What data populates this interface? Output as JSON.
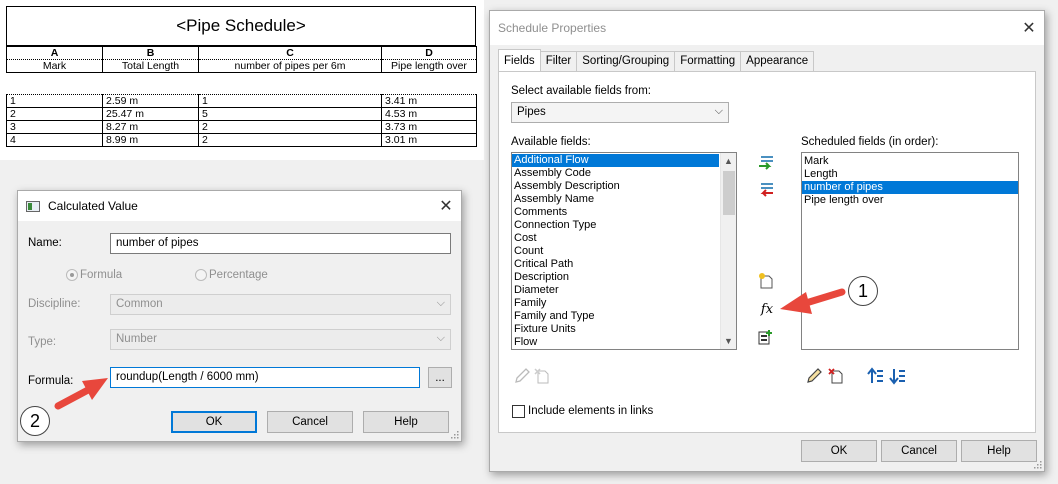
{
  "schedule": {
    "title": "<Pipe Schedule>",
    "letters": [
      "A",
      "B",
      "C",
      "D"
    ],
    "headers": [
      "Mark",
      "Total Length",
      "number of pipes per 6m",
      "Pipe length over"
    ],
    "rows": [
      [
        "1",
        "2.59 m",
        "1",
        "3.41 m"
      ],
      [
        "2",
        "25.47 m",
        "5",
        "4.53 m"
      ],
      [
        "3",
        "8.27 m",
        "2",
        "3.73 m"
      ],
      [
        "4",
        "8.99 m",
        "2",
        "3.01 m"
      ]
    ]
  },
  "calc": {
    "title": "Calculated Value",
    "name_label": "Name:",
    "name_value": "number of pipes",
    "formula_radio": "Formula",
    "percentage_radio": "Percentage",
    "discipline_label": "Discipline:",
    "discipline_value": "Common",
    "type_label": "Type:",
    "type_value": "Number",
    "formula_label": "Formula:",
    "formula_value": "roundup(Length / 6000 mm)",
    "browse_label": "...",
    "ok": "OK",
    "cancel": "Cancel",
    "help": "Help"
  },
  "props": {
    "title": "Schedule Properties",
    "tabs": [
      "Fields",
      "Filter",
      "Sorting/Grouping",
      "Formatting",
      "Appearance"
    ],
    "select_from_label": "Select available fields from:",
    "select_from_value": "Pipes",
    "available_label": "Available fields:",
    "available_fields": [
      "Additional Flow",
      "Assembly Code",
      "Assembly Description",
      "Assembly Name",
      "Comments",
      "Connection Type",
      "Cost",
      "Count",
      "Critical Path",
      "Description",
      "Diameter",
      "Family",
      "Family and Type",
      "Fixture Units",
      "Flow"
    ],
    "scheduled_label": "Scheduled fields (in order):",
    "scheduled_fields": [
      "Mark",
      "Length",
      "number of pipes",
      "Pipe length over"
    ],
    "include_links": "Include elements in links",
    "fx_label": "fx",
    "ok": "OK",
    "cancel": "Cancel",
    "help": "Help"
  },
  "callouts": [
    "1",
    "2"
  ],
  "colors": {
    "selection": "#0078d7",
    "arrow": "#e8473c"
  }
}
